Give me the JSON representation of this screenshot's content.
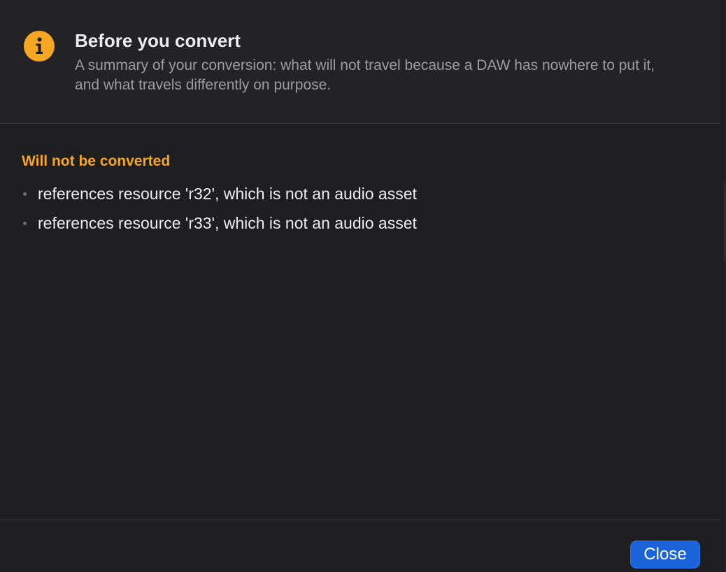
{
  "header": {
    "icon": "info-icon",
    "title": "Before you convert",
    "subtitle": "A summary of your conversion: what will not travel because a DAW has nowhere to put it, and what travels differently on purpose."
  },
  "sections": [
    {
      "title": "Will not be converted",
      "items": [
        "references resource 'r32', which is not an audio asset",
        "references resource 'r33', which is not an audio asset"
      ]
    }
  ],
  "footer": {
    "close_label": "Close"
  },
  "colors": {
    "background": "#1e1e20",
    "accent_warning": "#f5a623",
    "button_primary": "#1a63d8"
  }
}
